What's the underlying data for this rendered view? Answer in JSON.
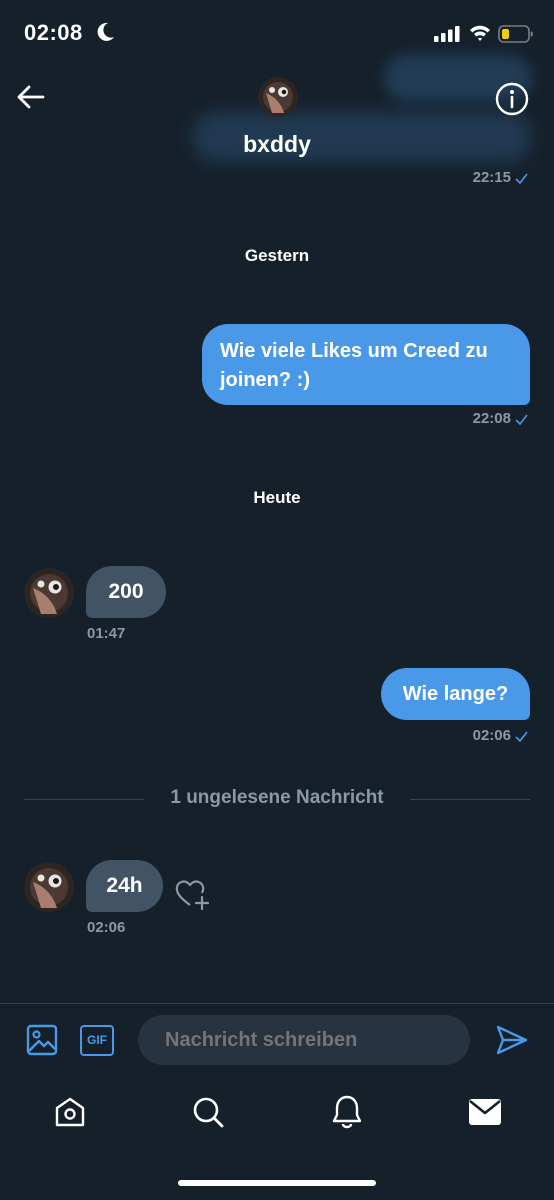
{
  "status_bar": {
    "time": "02:08"
  },
  "header": {
    "name": "bxddy"
  },
  "conversation": {
    "prev_timestamp": "22:15",
    "day_yesterday": "Gestern",
    "msg1": {
      "text": "Wie viele Likes um Creed zu joinen? :)",
      "time": "22:08"
    },
    "day_today": "Heute",
    "msg2": {
      "text": "200",
      "time": "01:47"
    },
    "msg3": {
      "text": "Wie lange?",
      "time": "02:06"
    },
    "unread_label": "1 ungelesene Nachricht",
    "msg4": {
      "text": "24h",
      "time": "02:06"
    }
  },
  "composer": {
    "placeholder": "Nachricht schreiben",
    "gif_label": "GIF"
  },
  "colors": {
    "background": "#15202b",
    "accent": "#4a99e9",
    "incoming": "#425366",
    "muted": "#8b98a5"
  }
}
